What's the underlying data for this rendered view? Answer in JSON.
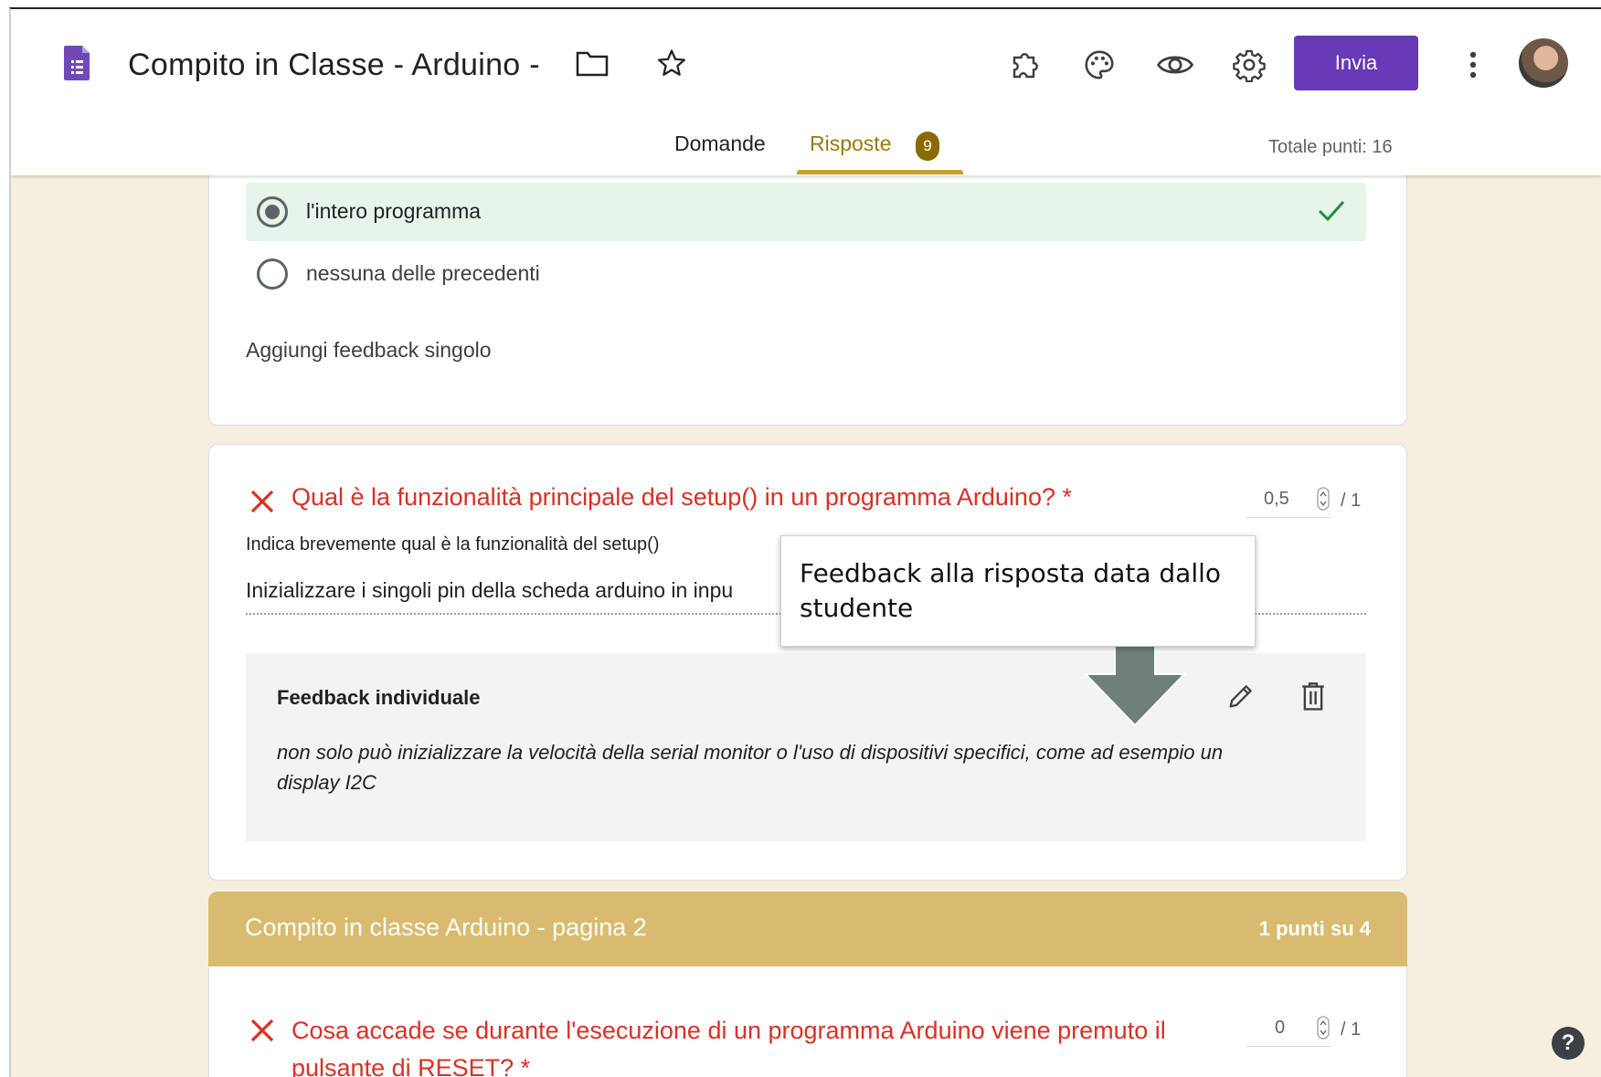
{
  "header": {
    "title": "Compito in Classe - Arduino -",
    "send_label": "Invia",
    "icons": [
      "forms-icon",
      "folder-icon",
      "star-icon",
      "addons-icon",
      "palette-icon",
      "preview-icon",
      "settings-icon",
      "more-vert-icon"
    ]
  },
  "tabs": [
    {
      "label": "Domande",
      "active": false
    },
    {
      "label": "Risposte",
      "active": true,
      "badge": "9"
    }
  ],
  "total_points": "Totale punti: 16",
  "prev_question": {
    "options": [
      {
        "label": "l'intero programma",
        "selected": true,
        "correct": true
      },
      {
        "label": "nessuna delle precedenti",
        "selected": false
      }
    ],
    "feedback_link": "Aggiungi feedback singolo"
  },
  "question": {
    "title": "Qual è la funzionalità principale del setup() in un programma Arduino? *",
    "score": "0,5",
    "max": "/ 1",
    "description": "Indica brevemente qual è la funzionalità del setup()",
    "answer": "Inizializzare i singoli pin della scheda arduino in inpu",
    "feedback_title": "Feedback individuale",
    "feedback_text": "non solo può inizializzare la velocità della serial monitor o l'uso di dispositivi specifici, come ad esempio un display I2C"
  },
  "callout": "Feedback alla risposta data dallo studente",
  "section": {
    "title": "Compito in classe Arduino - pagina 2",
    "points": "1 punti su 4"
  },
  "next_question": {
    "title": "Cosa accade se durante l'esecuzione di un programma Arduino viene premuto il pulsante di RESET? *",
    "score": "0",
    "max": "/ 1"
  },
  "colors": {
    "accent": "#673ab7",
    "tab_active": "#9c7a09",
    "wrong": "#d93025",
    "correct_bg": "#e6f4ea",
    "section": "#d8bb6e"
  }
}
